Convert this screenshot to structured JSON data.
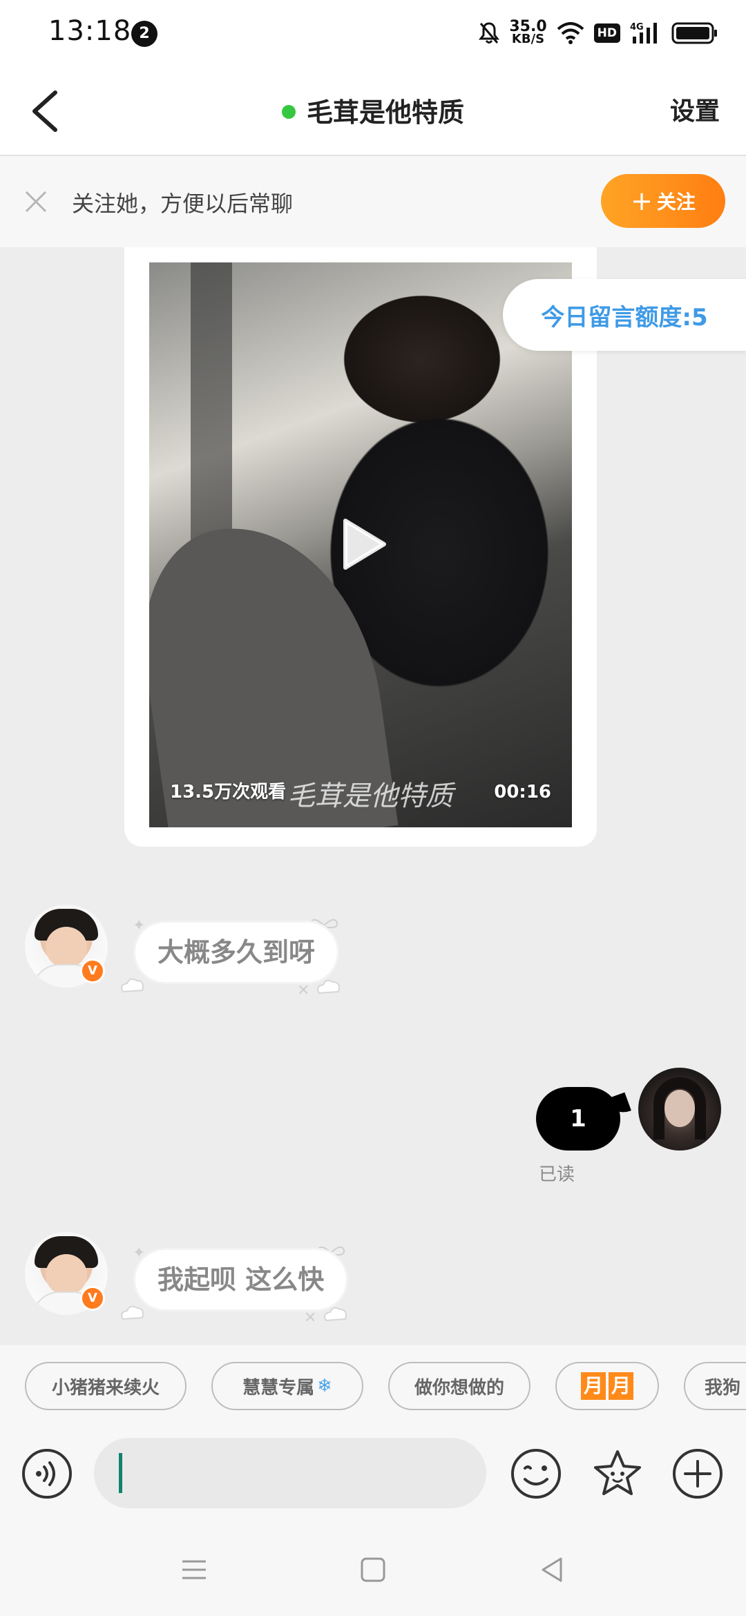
{
  "status_bar": {
    "time": "13:18",
    "notification_count": "2",
    "net_speed_value": "35.0",
    "net_speed_unit": "KB/S",
    "hd_label": "HD",
    "network_label": "4G"
  },
  "header": {
    "title": "毛茸是他特质",
    "settings_label": "设置",
    "online_color": "#36c740"
  },
  "follow_bar": {
    "text": "关注她，方便以后常聊",
    "button_label": "关注",
    "button_color": "#ff8b1a"
  },
  "video": {
    "views": "13.5万次观看",
    "duration": "00:16",
    "watermark": "毛茸是他特质"
  },
  "quota": {
    "label": "今日留言额度:5"
  },
  "messages": [
    {
      "side": "left",
      "text": "大概多久到呀",
      "badge": "V"
    },
    {
      "side": "right",
      "text": "1",
      "status": "已读"
    },
    {
      "side": "left",
      "text": "我起呗 这么快",
      "badge": "V"
    }
  ],
  "quick_replies": [
    "小猪猪来续火",
    "慧慧专属",
    "做你想做的",
    "月",
    "月",
    "我狗"
  ],
  "input": {
    "value": "",
    "accent_color": "#11826f"
  },
  "icons": [
    "back-icon",
    "close-icon",
    "play-icon",
    "voice-icon",
    "emoji-icon",
    "sticker-star-icon",
    "plus-icon",
    "snowflake-icon",
    "nav-menu-icon",
    "nav-home-icon",
    "nav-back-icon"
  ]
}
